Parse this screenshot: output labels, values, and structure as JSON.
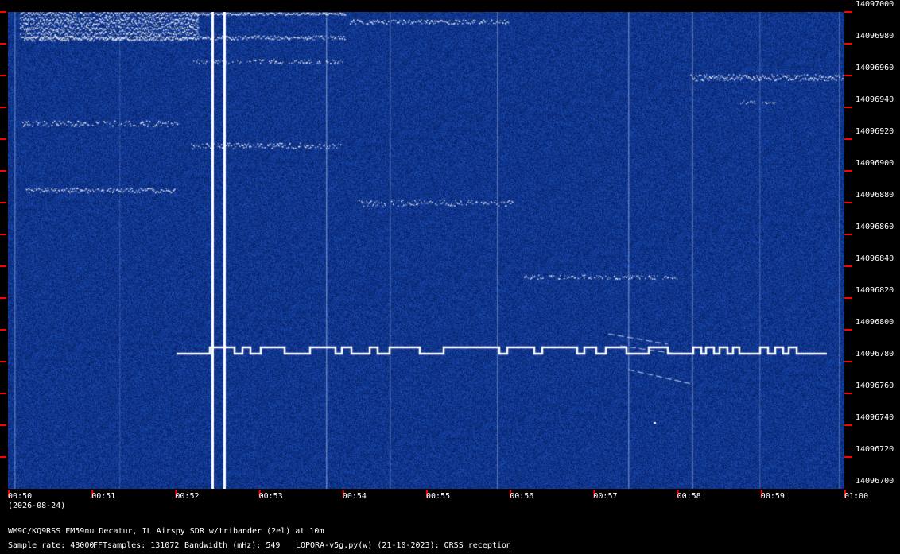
{
  "y_axis": {
    "labels": [
      "14097000",
      "14096980",
      "14096960",
      "14096940",
      "14096920",
      "14096900",
      "14096880",
      "14096860",
      "14096840",
      "14096820",
      "14096800",
      "14096780",
      "14096760",
      "14096740",
      "14096720",
      "14096700"
    ]
  },
  "x_axis": {
    "labels": [
      "00:50",
      "00:51",
      "00:52",
      "00:53",
      "00:54",
      "00:55",
      "00:56",
      "00:57",
      "00:58",
      "00:59",
      "01:00"
    ],
    "date": "(2026-08-24)"
  },
  "info": {
    "station": "WM9C/KQ9RSS EM59nu Decatur, IL  Airspy SDR w/tribander (2el) at 10m",
    "sample_rate": "Sample rate: 48000",
    "fft_samples": "FFTsamples: 131072",
    "bandwidth": "Bandwidth (mHz): 549",
    "software": "LOPORA-v5g.py(w) (21-10-2023): QRSS reception"
  },
  "colors": {
    "background": "#000000",
    "spectrogram": "#0b2a66",
    "signal": "#ffffff",
    "tick": "#ff0000"
  }
}
